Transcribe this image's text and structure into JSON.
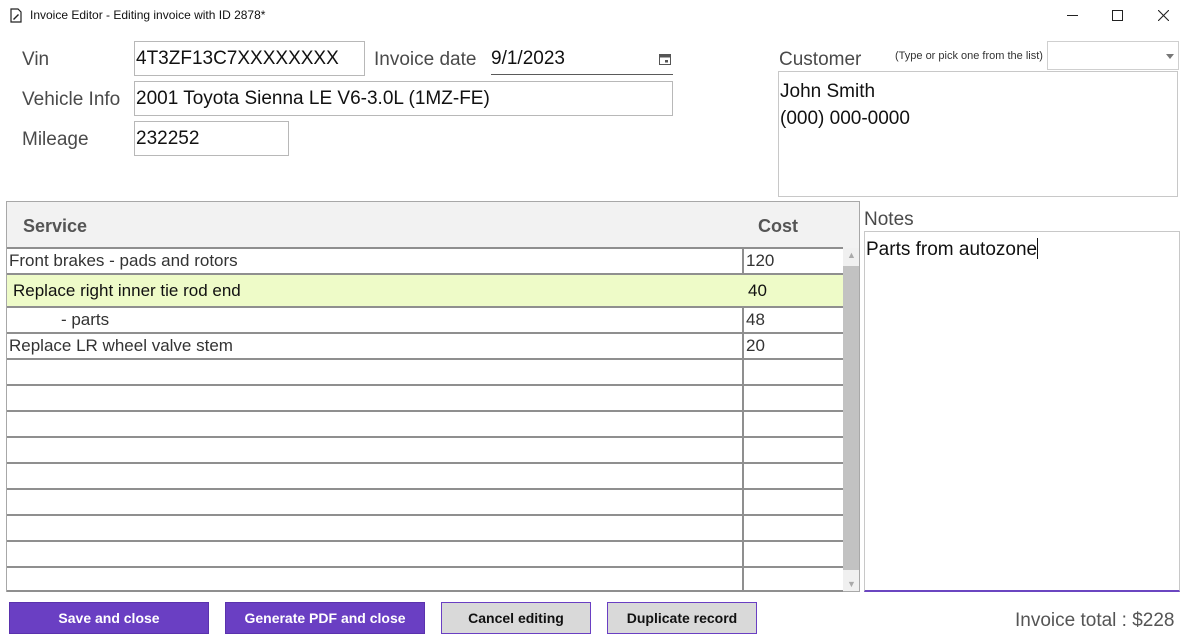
{
  "window": {
    "title": "Invoice Editor - Editing invoice with ID 2878*",
    "minimize_glyph": "─",
    "app_icon": "document-edit-icon"
  },
  "vehicle": {
    "vin_label": "Vin",
    "vin_value": "4T3ZF13C7XXXXXXXX",
    "info_label": "Vehicle Info",
    "info_value": "2001 Toyota Sienna LE V6-3.0L (1MZ-FE)",
    "mileage_label": "Mileage",
    "mileage_value": "232252"
  },
  "invoice": {
    "date_label": "Invoice date",
    "date_value": "9/1/2023"
  },
  "customer": {
    "label": "Customer",
    "hint": "(Type or pick one from the list)",
    "selected": "",
    "name": "John Smith",
    "phone": "(000) 000-0000"
  },
  "grid": {
    "headers": {
      "service": "Service",
      "cost": "Cost"
    },
    "rows": [
      {
        "service": "Front brakes - pads and rotors",
        "cost": "120"
      },
      {
        "service": "Replace right inner tie rod end",
        "cost": "40"
      },
      {
        "service": "           - parts",
        "cost": "48"
      },
      {
        "service": "Replace LR wheel valve stem",
        "cost": "20"
      },
      {
        "service": "",
        "cost": ""
      },
      {
        "service": "",
        "cost": ""
      },
      {
        "service": "",
        "cost": ""
      },
      {
        "service": "",
        "cost": ""
      },
      {
        "service": "",
        "cost": ""
      },
      {
        "service": "",
        "cost": ""
      },
      {
        "service": "",
        "cost": ""
      },
      {
        "service": "",
        "cost": ""
      },
      {
        "service": "",
        "cost": ""
      }
    ]
  },
  "notes": {
    "label": "Notes",
    "text": "Parts from autozone"
  },
  "buttons": {
    "save": "Save and close",
    "pdf": "Generate PDF and close",
    "cancel": "Cancel editing",
    "duplicate": "Duplicate record"
  },
  "total": {
    "text": "Invoice total : $228"
  },
  "colors": {
    "accent": "#6a3fc3",
    "selected_row": "#eefbc8"
  }
}
